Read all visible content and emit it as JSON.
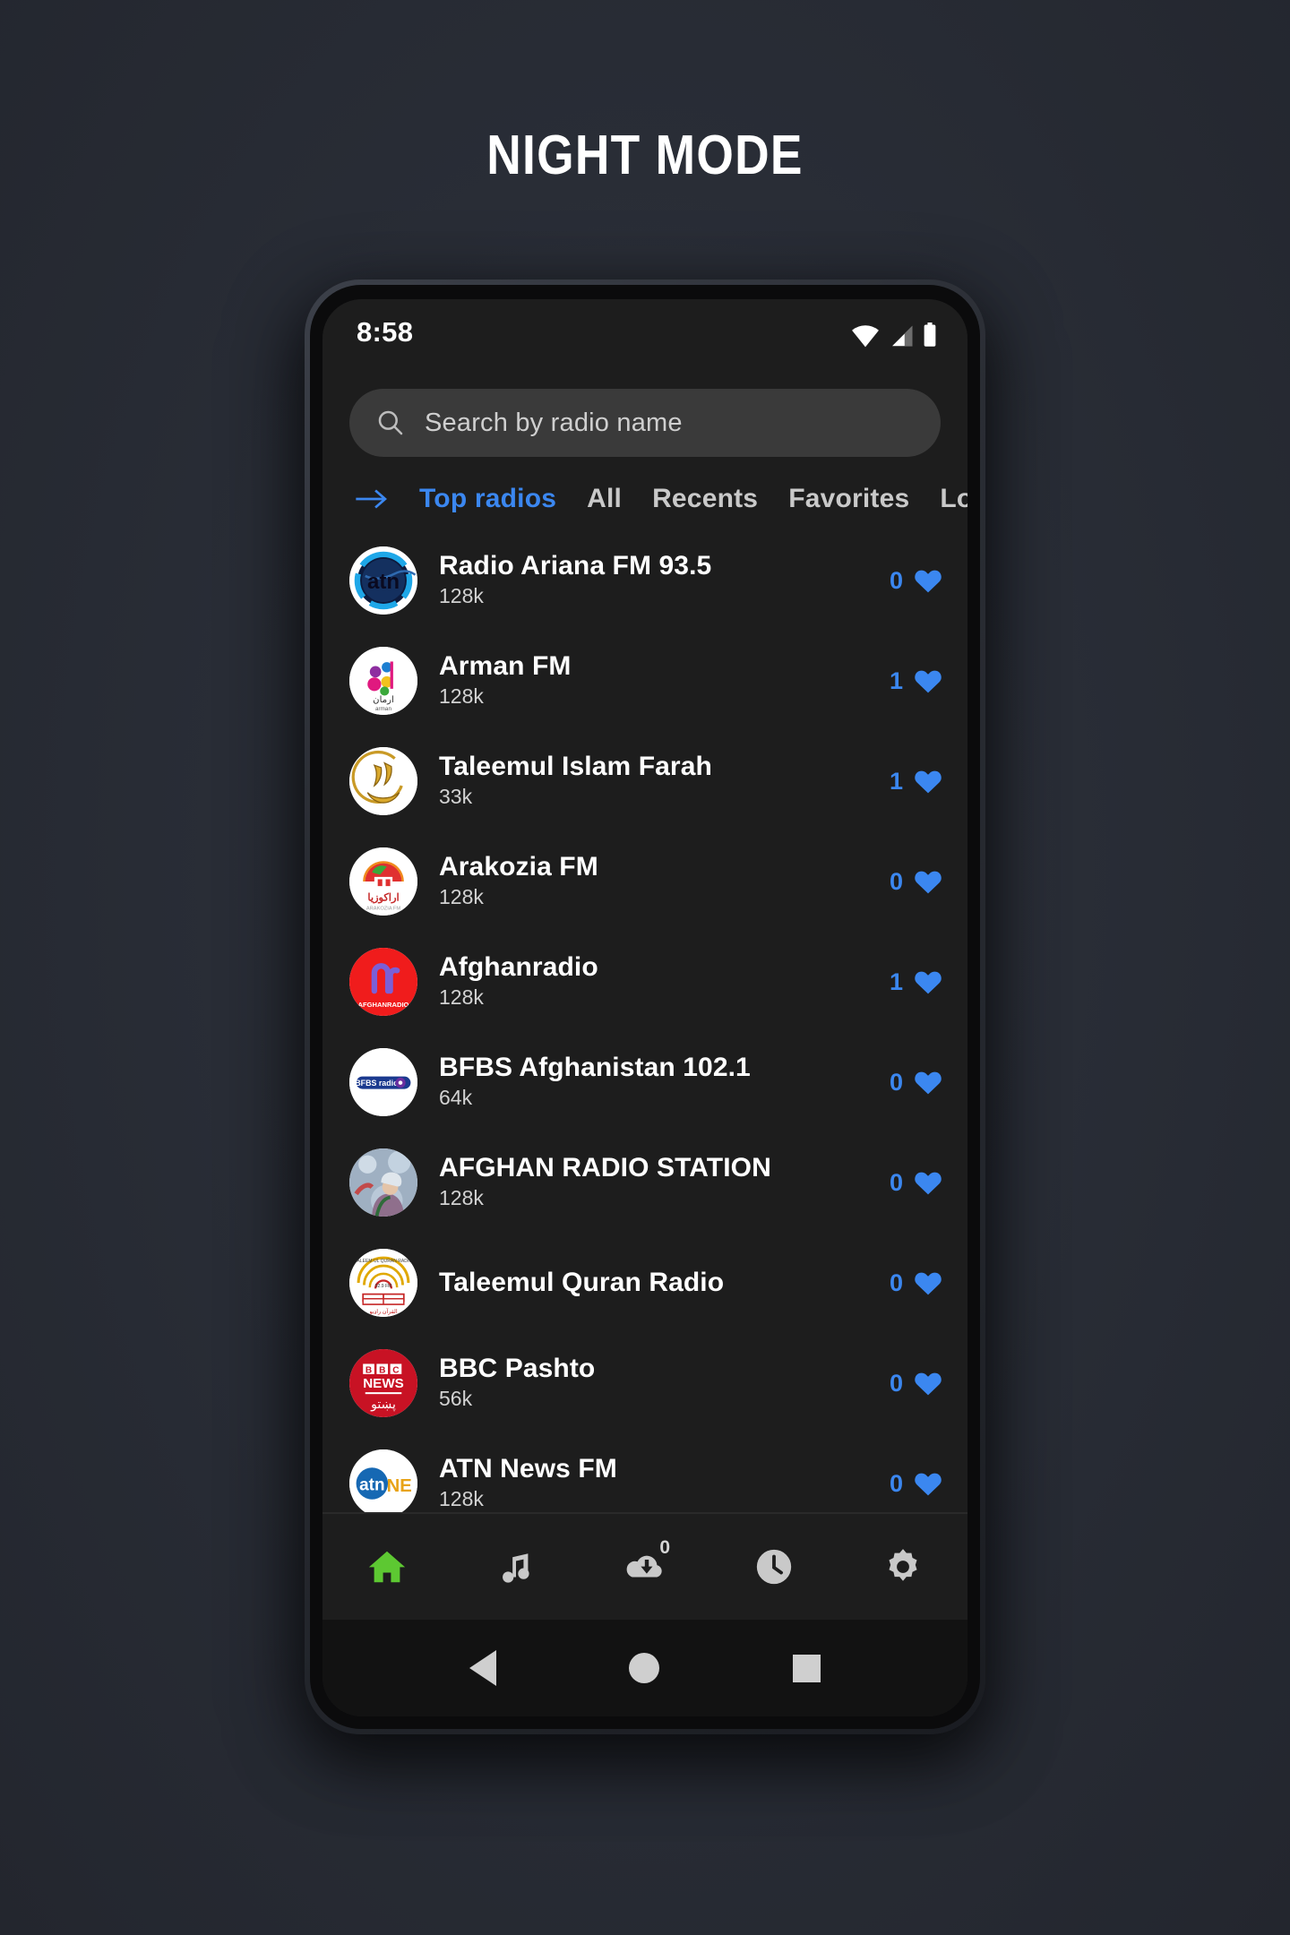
{
  "headline": "NIGHT MODE",
  "statusbar": {
    "time": "8:58",
    "icons": [
      "wifi-icon",
      "signal-icon",
      "battery-icon"
    ]
  },
  "search": {
    "placeholder": "Search by radio name",
    "value": "",
    "icon": "search-icon"
  },
  "tabs": {
    "arrow_icon": "arrow-right-icon",
    "items": [
      {
        "label": "Top radios",
        "active": true
      },
      {
        "label": "All",
        "active": false
      },
      {
        "label": "Recents",
        "active": false
      },
      {
        "label": "Favorites",
        "active": false
      },
      {
        "label": "Loc",
        "active": false
      }
    ]
  },
  "colors": {
    "accent_blue": "#3b87f0",
    "active_nav_green": "#5dc832",
    "screen_bg": "#1d1d1d",
    "search_bg": "#3a3a3a",
    "page_bg": "#282c35"
  },
  "radio_list": [
    {
      "name": "Radio Ariana FM 93.5",
      "bitrate": "128k",
      "favorites": "0",
      "logo": "ariana-atn-globe-logo"
    },
    {
      "name": "Arman FM",
      "bitrate": "128k",
      "favorites": "1",
      "logo": "arman-fm-logo"
    },
    {
      "name": "Taleemul Islam Farah",
      "bitrate": "33k",
      "favorites": "1",
      "logo": "taleemul-islam-farah-logo"
    },
    {
      "name": "Arakozia FM",
      "bitrate": "128k",
      "favorites": "0",
      "logo": "arakozia-fm-logo"
    },
    {
      "name": "Afghanradio",
      "bitrate": "128k",
      "favorites": "1",
      "logo": "afghanradio-logo"
    },
    {
      "name": "BFBS Afghanistan 102.1",
      "bitrate": "64k",
      "favorites": "0",
      "logo": "bfbs-radio-logo"
    },
    {
      "name": "AFGHAN RADIO STATION",
      "bitrate": "128k",
      "favorites": "0",
      "logo": "afghan-radio-station-photo-logo"
    },
    {
      "name": "Taleemul Quran Radio",
      "bitrate": "",
      "favorites": "0",
      "logo": "taleemul-quran-radio-logo"
    },
    {
      "name": "BBC Pashto",
      "bitrate": "56k",
      "favorites": "0",
      "logo": "bbc-news-pashto-logo"
    },
    {
      "name": "ATN News FM",
      "bitrate": "128k",
      "favorites": "0",
      "logo": "atn-news-logo"
    }
  ],
  "bottom_nav": [
    {
      "name": "home",
      "icon": "home-icon",
      "active": true,
      "badge": ""
    },
    {
      "name": "music",
      "icon": "music-note-icon",
      "active": false,
      "badge": ""
    },
    {
      "name": "downloads",
      "icon": "cloud-download-icon",
      "active": false,
      "badge": "0"
    },
    {
      "name": "history",
      "icon": "clock-icon",
      "active": false,
      "badge": ""
    },
    {
      "name": "settings",
      "icon": "gear-icon",
      "active": false,
      "badge": ""
    }
  ],
  "android_nav": [
    {
      "name": "back",
      "icon": "triangle-back-icon"
    },
    {
      "name": "home",
      "icon": "circle-home-icon"
    },
    {
      "name": "recents",
      "icon": "square-recents-icon"
    }
  ]
}
